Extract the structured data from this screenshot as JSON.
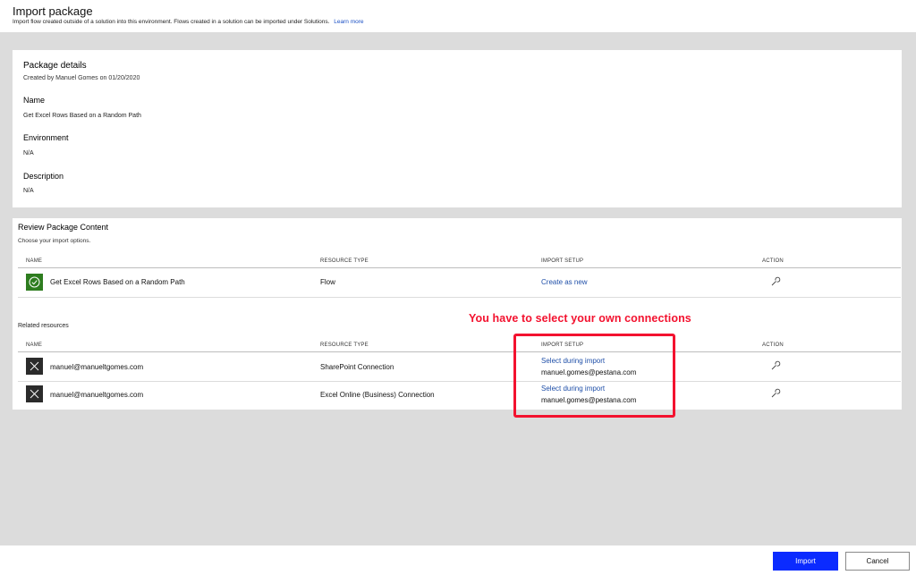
{
  "header": {
    "title": "Import package",
    "subtitle": "Import flow created outside of a solution into this environment. Flows created in a solution can be imported under Solutions.",
    "learn_more": "Learn more"
  },
  "package_details": {
    "heading": "Package details",
    "created_by": "Created by Manuel Gomes on 01/20/2020",
    "name_label": "Name",
    "name_value": "Get Excel Rows Based on a Random Path",
    "environment_label": "Environment",
    "environment_value": "N/A",
    "description_label": "Description",
    "description_value": "N/A"
  },
  "review": {
    "heading": "Review Package Content",
    "subheading": "Choose your import options.",
    "columns": {
      "name": "NAME",
      "resource_type": "RESOURCE TYPE",
      "import_setup": "IMPORT SETUP",
      "action": "ACTION"
    },
    "main_row": {
      "name": "Get Excel Rows Based on a Random Path",
      "resource_type": "Flow",
      "import_setup": "Create as new",
      "icon": "checkmark-circle-icon"
    },
    "related_label": "Related resources",
    "related_rows": [
      {
        "name": "manuel@manueltgomes.com",
        "resource_type": "SharePoint Connection",
        "import_setup": "Select during import",
        "connection": "manuel.gomes@pestana.com",
        "icon": "close-x-icon"
      },
      {
        "name": "manuel@manueltgomes.com",
        "resource_type": "Excel Online (Business) Connection",
        "import_setup": "Select during import",
        "connection": "manuel.gomes@pestana.com",
        "icon": "close-x-icon"
      }
    ]
  },
  "annotation": {
    "text": "You have to select your own connections",
    "color": "#f3122f"
  },
  "footer": {
    "import_label": "Import",
    "cancel_label": "Cancel",
    "import_color": "#0b2bff"
  }
}
